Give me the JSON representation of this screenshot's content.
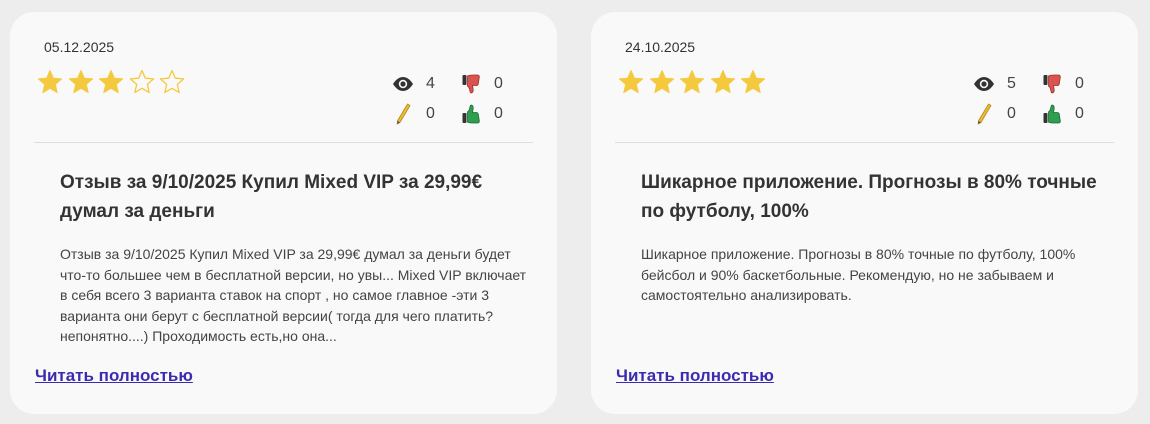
{
  "reviews": [
    {
      "date": "05.12.2025",
      "rating": 3,
      "max_rating": 5,
      "views": "4",
      "dislikes": "0",
      "edits": "0",
      "likes": "0",
      "title": "Отзыв за 9/10/2025 Купил Mixed VIP за 29,99€ думал за деньги",
      "text": "Отзыв за 9/10/2025 Купил Mixed VIP за 29,99€ думал за деньги будет что-то большее чем в бесплатной версии, но увы... Mixed VIP включает в себя всего 3 варианта ставок на спорт , но самое главное -эти 3 варианта они берут с бесплатной версии( тогда для чего платить? непонятно....) Проходимость есть,но она...",
      "read_more": "Читать полностью"
    },
    {
      "date": "24.10.2025",
      "rating": 5,
      "max_rating": 5,
      "views": "5",
      "dislikes": "0",
      "edits": "0",
      "likes": "0",
      "title": "Шикарное приложение. Прогнозы в 80% точные по футболу, 100%",
      "text": "Шикарное приложение. Прогнозы в 80% точные по футболу, 100% бейсбол и 90% баскетбольные. Рекомендую, но не забываем и самостоятельно анализировать.",
      "read_more": "Читать полностью"
    }
  ],
  "icons": {
    "star": "star-icon",
    "views": "eye-icon",
    "dislikes": "thumbs-down-icon",
    "edits": "pencil-icon",
    "likes": "thumbs-up-icon"
  },
  "colors": {
    "star_filled": "#f5c93e",
    "star_empty_stroke": "#f5c93e",
    "dislike": "#d9534f",
    "like": "#2e9e4f",
    "pencil": "#e8b93a",
    "link": "#3a2cb0"
  }
}
